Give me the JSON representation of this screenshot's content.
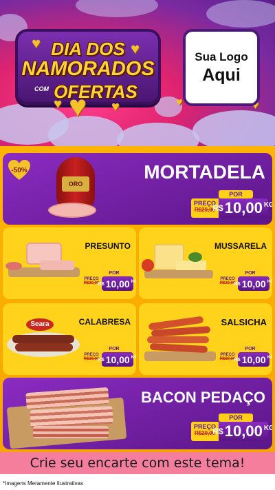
{
  "header": {
    "title_line1": "DIA DOS",
    "title_line2": "NAMORADOS",
    "title_small": "COM",
    "title_line3": "OFERTAS",
    "logo_line1": "Sua Logo",
    "logo_line2": "Aqui"
  },
  "products": [
    {
      "name": "MORTADELA",
      "badge": "-50%",
      "label": "ORO",
      "old_label": "PREÇO",
      "old_price": "R$20,00",
      "por": "POR",
      "currency": "R$",
      "price": "10,00",
      "unit": "KG"
    },
    {
      "name": "PRESUNTO",
      "old_label": "PREÇO",
      "old_price": "R$20,00",
      "por": "POR",
      "currency": "R$",
      "price": "10,00",
      "unit": "KG"
    },
    {
      "name": "MUSSARELA",
      "old_label": "PREÇO",
      "old_price": "R$20,00",
      "por": "POR",
      "currency": "R$",
      "price": "10,00",
      "unit": "KG"
    },
    {
      "name": "CALABRESA",
      "brand": "Seara",
      "old_label": "PREÇO",
      "old_price": "R$20,00",
      "por": "POR",
      "currency": "R$",
      "price": "10,00",
      "unit": "KG"
    },
    {
      "name": "SALSICHA",
      "old_label": "PREÇO",
      "old_price": "R$20,00",
      "por": "POR",
      "currency": "R$",
      "price": "10,00",
      "unit": "KG"
    },
    {
      "name": "BACON PEDAÇO",
      "old_label": "PREÇO",
      "old_price": "R$20,00",
      "por": "POR",
      "currency": "R$",
      "price": "10,00",
      "unit": "KG"
    }
  ],
  "footer": {
    "cta": "Crie seu encarte com este tema!",
    "disclaimer": "*Imagens Meramente Ilustrativas"
  },
  "colors": {
    "purple": "#6b1fa0",
    "yellow": "#ffd21c",
    "orange": "#f5a300",
    "pink": "#f57e9c",
    "gold": "#f6c22a"
  }
}
